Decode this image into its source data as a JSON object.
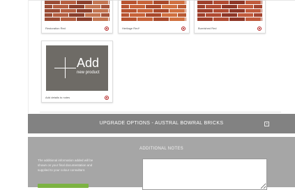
{
  "products": [
    {
      "name": "Restoration Red",
      "colors": [
        "#9a4b34",
        "#b45e40",
        "#8b3f2c",
        "#c27450",
        "#a5543a"
      ]
    },
    {
      "name": "Heritage Red*",
      "colors": [
        "#b8532f",
        "#c76238",
        "#a9482a",
        "#d07040",
        "#b95a33"
      ]
    },
    {
      "name": "Burnished Red",
      "colors": [
        "#9e3f2b",
        "#b04a31",
        "#8e3626",
        "#c05a3c",
        "#a44530"
      ]
    }
  ],
  "add_card": {
    "title": "Add",
    "subtitle": "new product",
    "label": "Add details to notes"
  },
  "upgrade": {
    "title": "UPGRADE OPTIONS - AUSTRAL BOWRAL BRICKS"
  },
  "notes": {
    "title": "ADDITIONAL NOTES",
    "info": "The additional information added will be shown on your final documentation and supplied to your colour consultant."
  },
  "colors": {
    "accent": "#b01c1c",
    "bar": "#828282",
    "notes_bg": "#a6a6a6",
    "button": "#7cb342"
  }
}
